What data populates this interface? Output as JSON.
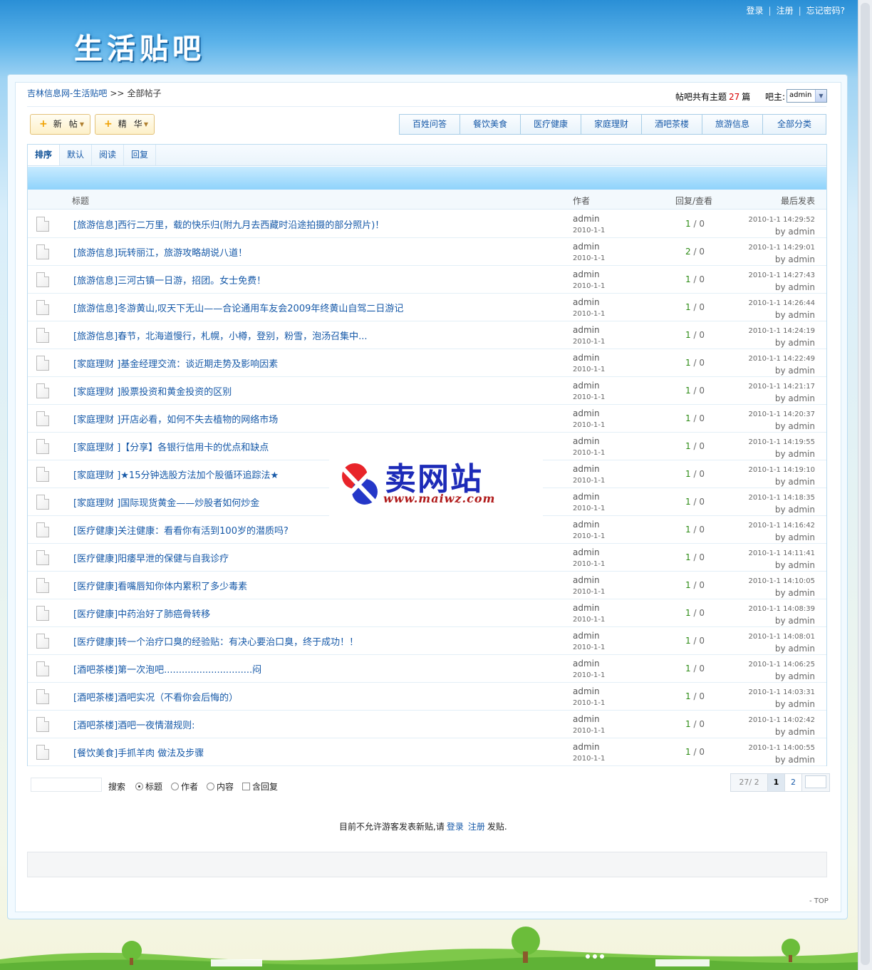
{
  "top_links": {
    "login": "登录",
    "register": "注册",
    "forgot": "忘记密码?"
  },
  "site_logo": "生活贴吧",
  "breadcrumb": {
    "home": "吉林信息网-生活贴吧",
    "sep": ">>",
    "current": "全部帖子"
  },
  "stats": {
    "prefix": "帖吧共有主题",
    "count": "27",
    "suffix": "篇",
    "master_label": "吧主:",
    "master_value": "admin"
  },
  "actions": {
    "new_post": "新帖",
    "digest": "精华"
  },
  "categories": [
    "百姓问答",
    "餐饮美食",
    "医疗健康",
    "家庭理财",
    "酒吧茶楼",
    "旅游信息",
    "全部分类"
  ],
  "sort_tabs": [
    "排序",
    "默认",
    "阅读",
    "回复"
  ],
  "columns": {
    "title": "标题",
    "author": "作者",
    "reply_view": "回复/查看",
    "last_post": "最后发表"
  },
  "posts": [
    {
      "cat": "[旅游信息]",
      "title": "西行二万里，载的快乐归(附九月去西藏时沿途拍摄的部分照片)！",
      "author": "admin",
      "date": "2010-1-1",
      "reply": "1",
      "view": "0",
      "last_time": "2010-1-1 14:29:52",
      "last_by": "by admin"
    },
    {
      "cat": "[旅游信息]",
      "title": "玩转丽江，旅游攻略胡说八道！",
      "author": "admin",
      "date": "2010-1-1",
      "reply": "2",
      "view": "0",
      "last_time": "2010-1-1 14:29:01",
      "last_by": "by admin"
    },
    {
      "cat": "[旅游信息]",
      "title": "三河古镇一日游，招团。女士免费！",
      "author": "admin",
      "date": "2010-1-1",
      "reply": "1",
      "view": "0",
      "last_time": "2010-1-1 14:27:43",
      "last_by": "by admin"
    },
    {
      "cat": "[旅游信息]",
      "title": "冬游黄山,叹天下无山——合论通用车友会2009年终黄山自驾二日游记",
      "author": "admin",
      "date": "2010-1-1",
      "reply": "1",
      "view": "0",
      "last_time": "2010-1-1 14:26:44",
      "last_by": "by admin"
    },
    {
      "cat": "[旅游信息]",
      "title": "春节，北海道慢行，札幌，小樽，登别，粉雪，泡汤召集中...",
      "author": "admin",
      "date": "2010-1-1",
      "reply": "1",
      "view": "0",
      "last_time": "2010-1-1 14:24:19",
      "last_by": "by admin"
    },
    {
      "cat": "[家庭理财 ]",
      "title": "基金经理交流：谈近期走势及影响因素",
      "author": "admin",
      "date": "2010-1-1",
      "reply": "1",
      "view": "0",
      "last_time": "2010-1-1 14:22:49",
      "last_by": "by admin"
    },
    {
      "cat": "[家庭理财 ]",
      "title": "股票投资和黄金投资的区别",
      "author": "admin",
      "date": "2010-1-1",
      "reply": "1",
      "view": "0",
      "last_time": "2010-1-1 14:21:17",
      "last_by": "by admin"
    },
    {
      "cat": "[家庭理财 ]",
      "title": "开店必看，如何不失去植物的网络市场",
      "author": "admin",
      "date": "2010-1-1",
      "reply": "1",
      "view": "0",
      "last_time": "2010-1-1 14:20:37",
      "last_by": "by admin"
    },
    {
      "cat": "[家庭理财 ]",
      "title": "【分享】各银行信用卡的优点和缺点",
      "author": "admin",
      "date": "2010-1-1",
      "reply": "1",
      "view": "0",
      "last_time": "2010-1-1 14:19:55",
      "last_by": "by admin"
    },
    {
      "cat": "[家庭理财 ]",
      "title": "★15分钟选股方法加个股循环追踪法★",
      "author": "admin",
      "date": "2010-1-1",
      "reply": "1",
      "view": "0",
      "last_time": "2010-1-1 14:19:10",
      "last_by": "by admin"
    },
    {
      "cat": "[家庭理财 ]",
      "title": "国际现货黄金——炒股者如何炒金",
      "author": "admin",
      "date": "2010-1-1",
      "reply": "1",
      "view": "0",
      "last_time": "2010-1-1 14:18:35",
      "last_by": "by admin"
    },
    {
      "cat": "[医疗健康]",
      "title": "关注健康：看看你有活到100岁的潜质吗?",
      "author": "admin",
      "date": "2010-1-1",
      "reply": "1",
      "view": "0",
      "last_time": "2010-1-1 14:16:42",
      "last_by": "by admin"
    },
    {
      "cat": "[医疗健康]",
      "title": "阳痿早泄的保健与自我诊疗",
      "author": "admin",
      "date": "2010-1-1",
      "reply": "1",
      "view": "0",
      "last_time": "2010-1-1 14:11:41",
      "last_by": "by admin"
    },
    {
      "cat": "[医疗健康]",
      "title": "看嘴唇知你体内累积了多少毒素",
      "author": "admin",
      "date": "2010-1-1",
      "reply": "1",
      "view": "0",
      "last_time": "2010-1-1 14:10:05",
      "last_by": "by admin"
    },
    {
      "cat": "[医疗健康]",
      "title": "中药治好了肺癌骨转移",
      "author": "admin",
      "date": "2010-1-1",
      "reply": "1",
      "view": "0",
      "last_time": "2010-1-1 14:08:39",
      "last_by": "by admin"
    },
    {
      "cat": "[医疗健康]",
      "title": "转一个治疗口臭的经验贴：有决心要治口臭，终于成功！！",
      "author": "admin",
      "date": "2010-1-1",
      "reply": "1",
      "view": "0",
      "last_time": "2010-1-1 14:08:01",
      "last_by": "by admin"
    },
    {
      "cat": "[酒吧茶楼]",
      "title": "第一次泡吧..............................闷",
      "author": "admin",
      "date": "2010-1-1",
      "reply": "1",
      "view": "0",
      "last_time": "2010-1-1 14:06:25",
      "last_by": "by admin"
    },
    {
      "cat": "[酒吧茶楼]",
      "title": "酒吧实况（不看你会后悔的）",
      "author": "admin",
      "date": "2010-1-1",
      "reply": "1",
      "view": "0",
      "last_time": "2010-1-1 14:03:31",
      "last_by": "by admin"
    },
    {
      "cat": "[酒吧茶楼]",
      "title": "酒吧一夜情潜规则:",
      "author": "admin",
      "date": "2010-1-1",
      "reply": "1",
      "view": "0",
      "last_time": "2010-1-1 14:02:42",
      "last_by": "by admin"
    },
    {
      "cat": "[餐饮美食]",
      "title": "手抓羊肉 做法及步骤",
      "author": "admin",
      "date": "2010-1-1",
      "reply": "1",
      "view": "0",
      "last_time": "2010-1-1 14:00:55",
      "last_by": "by admin"
    }
  ],
  "search": {
    "button": "搜索",
    "opt_title": "标题",
    "opt_author": "作者",
    "opt_content": "内容",
    "opt_replies": "含回复"
  },
  "pager": {
    "info": "27/ 2",
    "current": "1",
    "next": "2"
  },
  "guest_note": {
    "before": "目前不允许游客发表新贴,请",
    "login": "登录",
    "register": "注册",
    "after": "发贴."
  },
  "top_link": "- TOP",
  "watermark": {
    "name": "卖网站",
    "url": "www.maiwz.com"
  },
  "colors": {
    "link": "#1659a8",
    "reply_highlight": "#2a8a12",
    "count": "#d90000"
  }
}
